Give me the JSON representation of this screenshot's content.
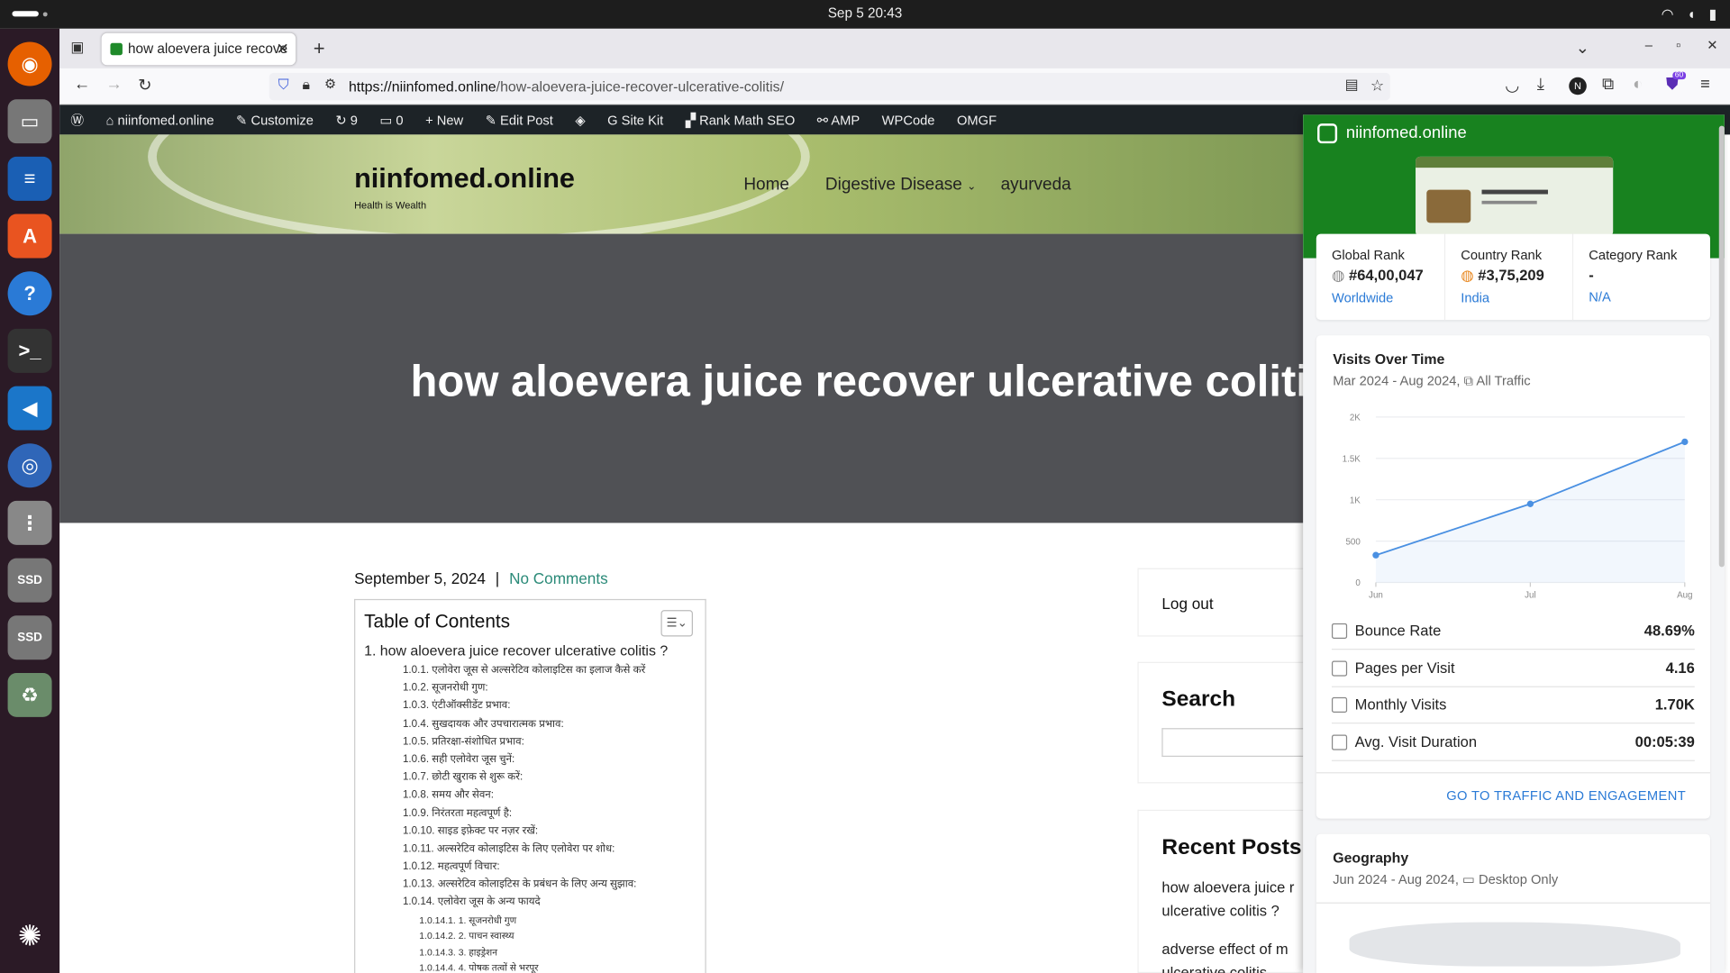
{
  "system": {
    "clock": "Sep 5  20:43"
  },
  "browser": {
    "tab_title": "how aloevera juice recove",
    "url_host": "https://niinfomed.online",
    "url_path": "/how-aloevera-juice-recover-ulcerative-colitis/",
    "ext_badge": "60"
  },
  "wpbar": {
    "site": "niinfomed.online",
    "customize": "Customize",
    "updates": "9",
    "comments": "0",
    "new": "New",
    "edit_post": "Edit Post",
    "site_kit": "Site Kit",
    "rank_math": "Rank Math SEO",
    "amp": "AMP",
    "wpcode": "WPCode",
    "omgf": "OMGF"
  },
  "site": {
    "title": "niinfomed.online",
    "tagline": "Health is Wealth",
    "menu": [
      "Home",
      "Digestive Disease",
      "ayurveda"
    ]
  },
  "post": {
    "title": "how aloevera juice recover ulcerative colitis",
    "date": "September 5, 2024",
    "separator": "|",
    "comments_link": "No Comments"
  },
  "toc": {
    "heading": "Table of Contents",
    "top": "1. how aloevera juice recover ulcerative colitis ?",
    "items": [
      "1.0.1. एलोवेरा जूस से अल्सरेटिव कोलाइटिस का इलाज कैसे करें",
      "1.0.2. सूजनरोधी गुण:",
      "1.0.3. एंटीऑक्सीडेंट प्रभाव:",
      "1.0.4. सुखदायक और उपचारात्मक प्रभाव:",
      "1.0.5. प्रतिरक्षा-संशोधित प्रभाव:",
      "1.0.6. सही एलोवेरा जूस चुनें:",
      "1.0.7. छोटी खुराक से शुरू करें:",
      "1.0.8. समय और सेवन:",
      "1.0.9. निरंतरता महत्वपूर्ण है:",
      "1.0.10. साइड इफ़ेक्ट पर नज़र रखें:",
      "1.0.11. अल्सरेटिव कोलाइटिस के लिए एलोवेरा पर शोध:",
      "1.0.12. महत्वपूर्ण विचार:",
      "1.0.13. अल्सरेटिव कोलाइटिस के प्रबंधन के लिए अन्य सुझाव:",
      "1.0.14. एलोवेरा जूस के अन्य फायदे"
    ],
    "subitems": [
      "1.0.14.1. 1. सूजनरोधी गुण",
      "1.0.14.2. 2. पाचन स्वास्थ्य",
      "1.0.14.3. 3. हाइड्रेशन",
      "1.0.14.4. 4. पोषक तत्वों से भरपूर"
    ]
  },
  "sidebar": {
    "logout": "Log out",
    "search_heading": "Search",
    "recent_heading": "Recent Posts",
    "recent": [
      "how aloevera juice r",
      "ulcerative colitis ?",
      "adverse effect of m",
      "ulcerative colitis"
    ]
  },
  "panel": {
    "site": "niinfomed.online",
    "ranks": [
      {
        "label": "Global Rank",
        "value": "#64,00,047",
        "sub": "Worldwide"
      },
      {
        "label": "Country Rank",
        "value": "#3,75,209",
        "sub": "India"
      },
      {
        "label": "Category Rank",
        "value": "-",
        "sub": "N/A"
      }
    ],
    "visits_title": "Visits Over Time",
    "visits_range": "Mar 2024 - Aug 2024,",
    "visits_filter": "All Traffic",
    "metrics": [
      {
        "label": "Bounce Rate",
        "value": "48.69%"
      },
      {
        "label": "Pages per Visit",
        "value": "4.16"
      },
      {
        "label": "Monthly Visits",
        "value": "1.70K"
      },
      {
        "label": "Avg. Visit Duration",
        "value": "00:05:39"
      }
    ],
    "cta": "GO TO TRAFFIC AND ENGAGEMENT",
    "geo_title": "Geography",
    "geo_range": "Jun 2024 - Aug 2024,",
    "geo_filter": "Desktop Only"
  },
  "chart_data": {
    "type": "line",
    "categories": [
      "Jun",
      "Jul",
      "Aug"
    ],
    "values": [
      330,
      950,
      1700
    ],
    "yticks": [
      "0",
      "500",
      "1K",
      "1.5K",
      "2K"
    ],
    "ylim": [
      0,
      2000
    ],
    "color": "#4a90e2"
  }
}
